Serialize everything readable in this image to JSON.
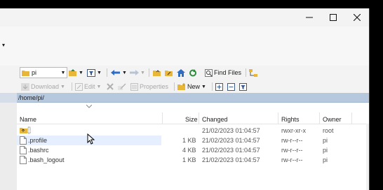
{
  "window": {
    "controls": [
      "minimize",
      "maximize",
      "close"
    ],
    "side_arrow": "▾"
  },
  "toolbar1": {
    "combo_value": "pi",
    "find_files_label": "Find Files"
  },
  "toolbar2": {
    "download_label": "Download",
    "edit_label": "Edit",
    "properties_label": "Properties",
    "new_label": "New"
  },
  "path": "/home/pi/",
  "columns": {
    "name": "Name",
    "size": "Size",
    "changed": "Changed",
    "rights": "Rights",
    "owner": "Owner"
  },
  "rows": [
    {
      "name": "",
      "size": "",
      "changed": "21/02/2023 01:04:57",
      "rights": "rwxr-xr-x",
      "owner": "root",
      "type": "parent-dir"
    },
    {
      "name": ".profile",
      "size": "1 KB",
      "changed": "21/02/2023 01:04:57",
      "rights": "rw-r--r--",
      "owner": "pi",
      "type": "file"
    },
    {
      "name": ".bashrc",
      "size": "4 KB",
      "changed": "21/02/2023 01:04:57",
      "rights": "rw-r--r--",
      "owner": "pi",
      "type": "file"
    },
    {
      "name": ".bash_logout",
      "size": "1 KB",
      "changed": "21/02/2023 01:04:57",
      "rights": "rw-r--r--",
      "owner": "pi",
      "type": "file"
    }
  ],
  "colors": {
    "pathbar": "#b6c8de",
    "hover_row": "#e5efff",
    "folder": "#e8b73a"
  }
}
